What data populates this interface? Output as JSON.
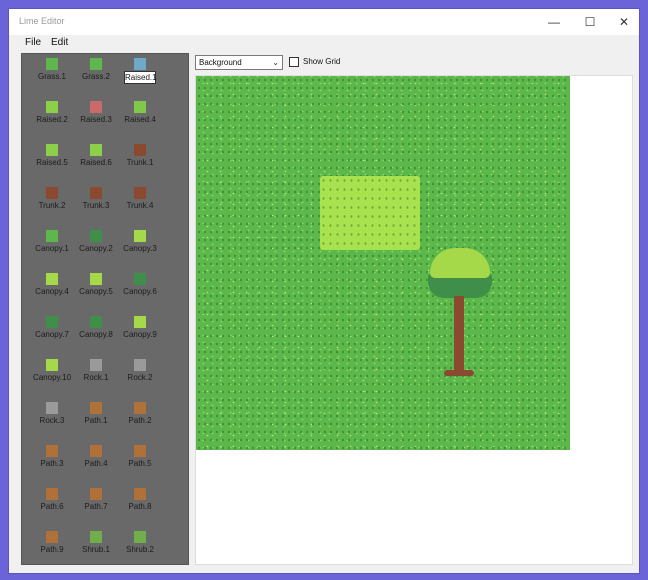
{
  "window": {
    "title": "Lime Editor",
    "controls": {
      "minimize": "—",
      "maximize": "☐",
      "close": "✕"
    }
  },
  "menu": [
    "File",
    "Edit"
  ],
  "toolbar": {
    "layer_select": "Background",
    "show_grid_label": "Show Grid",
    "show_grid_checked": false
  },
  "tiles": [
    {
      "label": "Grass.1",
      "color": "#5cb84a"
    },
    {
      "label": "Grass.2",
      "color": "#5cb84a"
    },
    {
      "label": "Raised.1",
      "color": "#6fa8c8",
      "selected": true
    },
    {
      "label": "Raised.2",
      "color": "#8ccf4a"
    },
    {
      "label": "Raised.3",
      "color": "#c86a6a"
    },
    {
      "label": "Raised.4",
      "color": "#7fc84a"
    },
    {
      "label": "Raised.5",
      "color": "#8ccf4a"
    },
    {
      "label": "Raised.6",
      "color": "#8ccf4a"
    },
    {
      "label": "Trunk.1",
      "color": "#8b4a2f"
    },
    {
      "label": "Trunk.2",
      "color": "#8b4a2f"
    },
    {
      "label": "Trunk.3",
      "color": "#8b4a2f"
    },
    {
      "label": "Trunk.4",
      "color": "#8b4a2f"
    },
    {
      "label": "Canopy.1",
      "color": "#5cb84a"
    },
    {
      "label": "Canopy.2",
      "color": "#3f8f4a"
    },
    {
      "label": "Canopy.3",
      "color": "#a6d94a"
    },
    {
      "label": "Canopy.4",
      "color": "#a6d94a"
    },
    {
      "label": "Canopy.5",
      "color": "#a6d94a"
    },
    {
      "label": "Canopy.6",
      "color": "#3f8f4a"
    },
    {
      "label": "Canopy.7",
      "color": "#3f8f4a"
    },
    {
      "label": "Canopy.8",
      "color": "#3f8f4a"
    },
    {
      "label": "Canopy.9",
      "color": "#a6d94a"
    },
    {
      "label": "Canopy.10",
      "color": "#a6d94a"
    },
    {
      "label": "Rock.1",
      "color": "#9a9a9a"
    },
    {
      "label": "Rock.2",
      "color": "#9a9a9a"
    },
    {
      "label": "Rock.3",
      "color": "#9a9a9a"
    },
    {
      "label": "Path.1",
      "color": "#b0703a"
    },
    {
      "label": "Path.2",
      "color": "#b0703a"
    },
    {
      "label": "Path.3",
      "color": "#b0703a"
    },
    {
      "label": "Path.4",
      "color": "#b0703a"
    },
    {
      "label": "Path.5",
      "color": "#b0703a"
    },
    {
      "label": "Path.6",
      "color": "#b0703a"
    },
    {
      "label": "Path.7",
      "color": "#b0703a"
    },
    {
      "label": "Path.8",
      "color": "#b0703a"
    },
    {
      "label": "Path.9",
      "color": "#b0703a"
    },
    {
      "label": "Shrub.1",
      "color": "#6fae4a"
    },
    {
      "label": "Shrub.2",
      "color": "#6fae4a"
    }
  ]
}
